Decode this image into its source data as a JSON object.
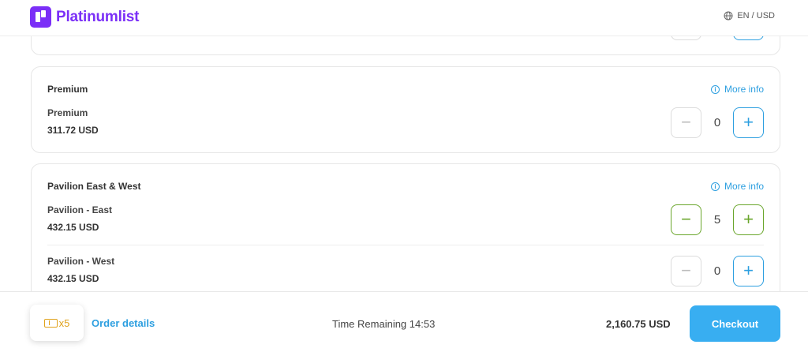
{
  "header": {
    "brand": "Platinumlist",
    "lang_currency": "EN / USD"
  },
  "sections": [
    {
      "title": "Premium",
      "more_info": "More info",
      "tickets": [
        {
          "name": "Premium",
          "price": "311.72 USD",
          "qty": "0"
        }
      ]
    },
    {
      "title": "Pavilion East & West",
      "more_info": "More info",
      "tickets": [
        {
          "name": "Pavilion - East",
          "price": "432.15 USD",
          "qty": "5"
        },
        {
          "name": "Pavilion - West",
          "price": "432.15 USD",
          "qty": "0"
        }
      ]
    }
  ],
  "footer": {
    "ticket_count": "x5",
    "order_details": "Order details",
    "time_remaining": "Time Remaining 14:53",
    "total": "2,160.75 USD",
    "checkout": "Checkout"
  },
  "colors": {
    "brand": "#7b2ff7",
    "accent": "#2d9fe0",
    "active": "#6aa62c",
    "checkout": "#38aef1",
    "ticket": "#e0a21b"
  }
}
